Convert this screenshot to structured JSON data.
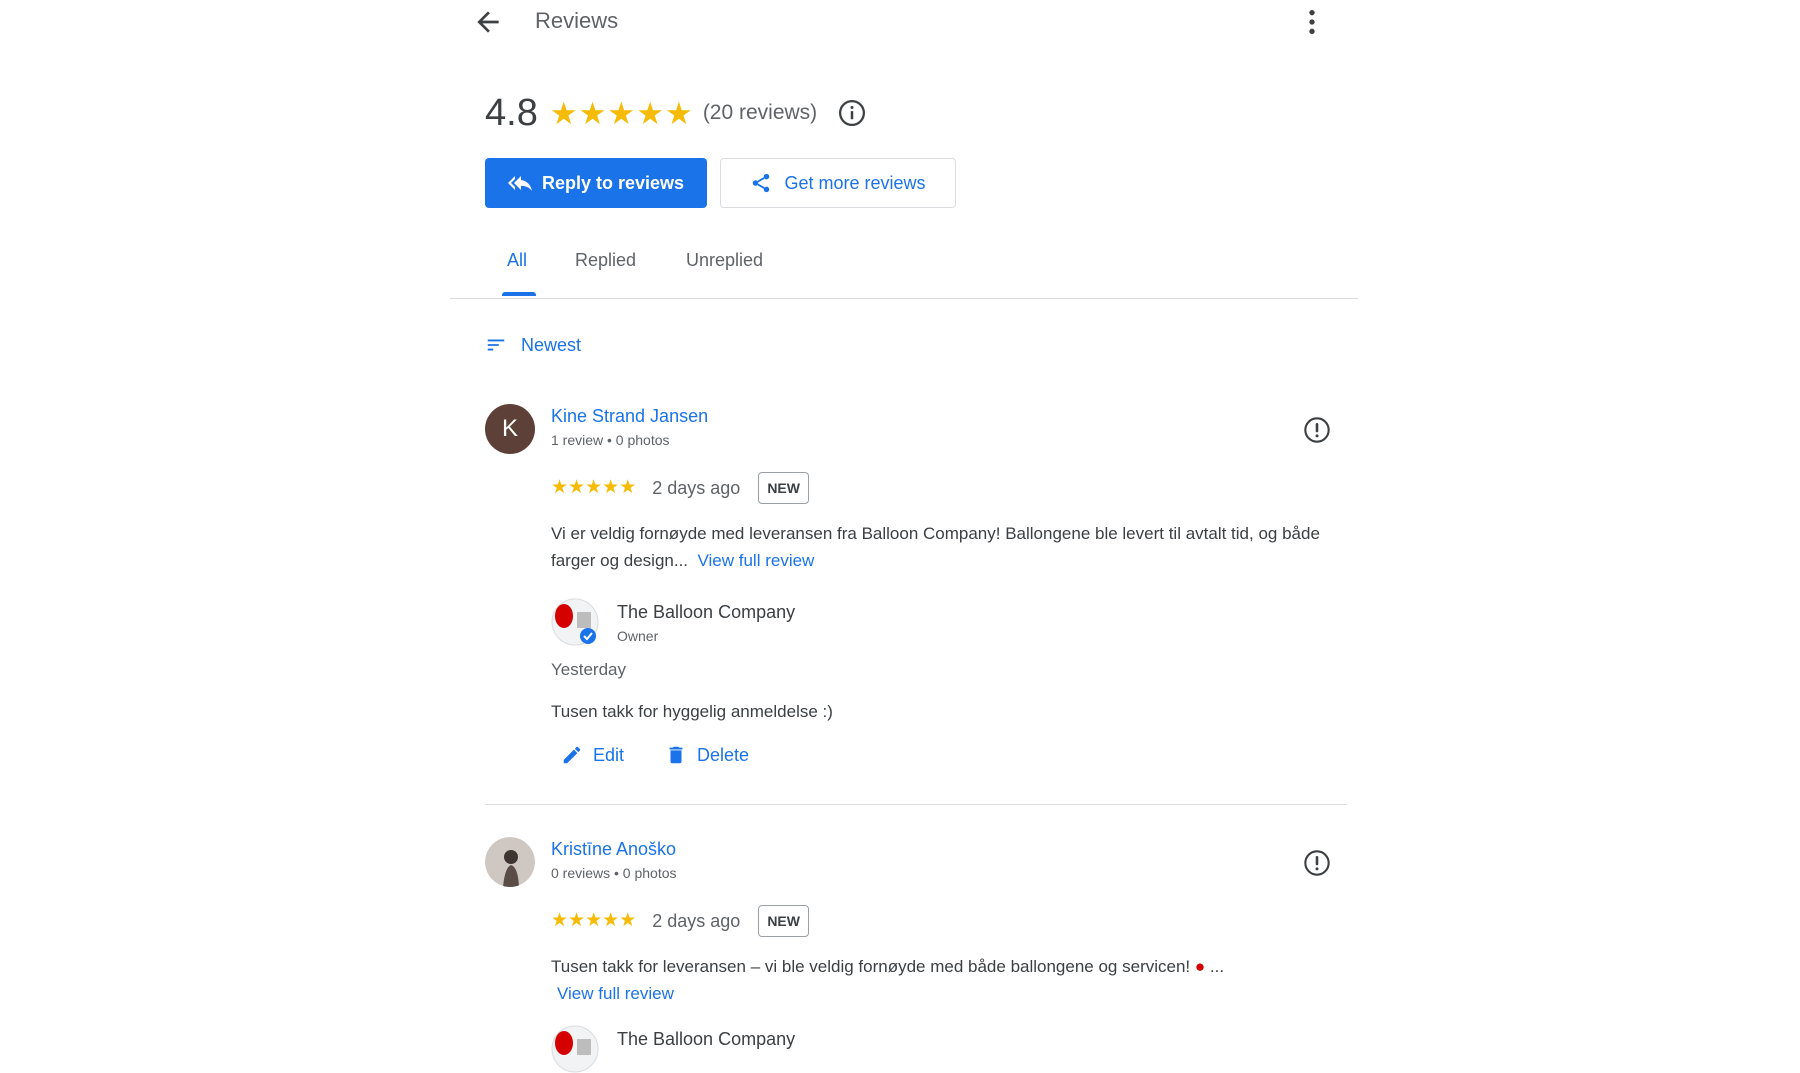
{
  "header": {
    "title": "Reviews"
  },
  "summary": {
    "average": "4.8",
    "count_text": "(20 reviews)",
    "star_color": "#f6bb06"
  },
  "buttons": {
    "reply": "Reply to reviews",
    "get_more": "Get more reviews"
  },
  "tabs": [
    {
      "label": "All",
      "active": true
    },
    {
      "label": "Replied",
      "active": false
    },
    {
      "label": "Unreplied",
      "active": false
    }
  ],
  "sort": {
    "label": "Newest"
  },
  "reviews": [
    {
      "initial": "K",
      "name": "Kine Strand Jansen",
      "meta": "1 review • 0 photos",
      "rating": 5,
      "ago": "2 days ago",
      "badge": "NEW",
      "text": "Vi er veldig fornøyde med leveransen fra Balloon Company! Ballongene ble levert til avtalt tid, og både farger og design...",
      "view_full": "View full review",
      "reply": {
        "owner_name": "The Balloon Company",
        "owner_role": "Owner",
        "date": "Yesterday",
        "text": "Tusen takk for hyggelig anmeldelse :)",
        "edit": "Edit",
        "delete": "Delete"
      }
    },
    {
      "name": "Kristīne Anoško",
      "meta": "0 reviews • 0 photos",
      "rating": 5,
      "ago": "2 days ago",
      "badge": "NEW",
      "text": "Tusen takk for leveransen – vi ble veldig fornøyde med både ballongene og servicen!",
      "ellipsis": "...",
      "view_full": "View full review",
      "reply": {
        "owner_name": "The Balloon Company"
      }
    }
  ],
  "colors": {
    "primary": "#1a73e8",
    "text": "#3c4043",
    "muted": "#5f6368",
    "border": "#dadce0"
  }
}
